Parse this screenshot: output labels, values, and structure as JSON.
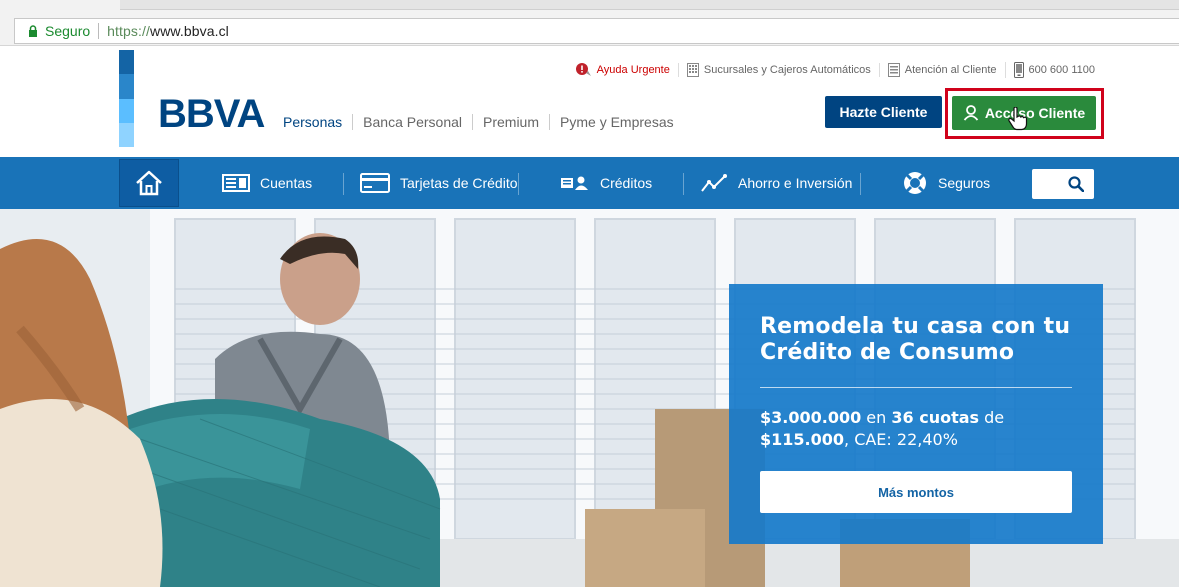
{
  "browser": {
    "secure_label": "Seguro",
    "url_protocol": "https://",
    "url_host": "www.bbva.cl"
  },
  "header": {
    "logo_text": "BBVA",
    "logo_colors": [
      "#1464a5",
      "#2a86ca",
      "#5bbeff",
      "#8fd3ff"
    ],
    "segments": [
      "Personas",
      "Banca Personal",
      "Premium",
      "Pyme y Empresas"
    ],
    "utility": {
      "urgent": "Ayuda Urgente",
      "branches": "Sucursales y Cajeros Automáticos",
      "customer_service": "Atención al Cliente",
      "phone": "600 600 1100"
    },
    "hazte_cliente": "Hazte Cliente",
    "acceso_cliente": "Acceso Cliente"
  },
  "nav": {
    "items": [
      {
        "label": "Cuentas",
        "icon": "account-icon"
      },
      {
        "label": "Tarjetas de Crédito",
        "icon": "credit-card-icon"
      },
      {
        "label": "Créditos",
        "icon": "credits-icon"
      },
      {
        "label": "Ahorro e Inversión",
        "icon": "investment-chart-icon"
      },
      {
        "label": "Seguros",
        "icon": "lifebuoy-icon"
      }
    ]
  },
  "promo": {
    "title_line1": "Remodela tu casa con tu",
    "title_line2": "Crédito de Consumo",
    "amount": "$3.000.000",
    "text_en": " en ",
    "term": "36 cuotas",
    "text_de": " de",
    "installment": "$115.000",
    "cae": ", CAE: 22,40%",
    "button": "Más montos"
  },
  "colors": {
    "brand_blue": "#004481",
    "nav_blue": "#1973b8",
    "green": "#2a8a3c",
    "highlight_red": "#d0021b",
    "promo_blue": "#1679ca"
  }
}
